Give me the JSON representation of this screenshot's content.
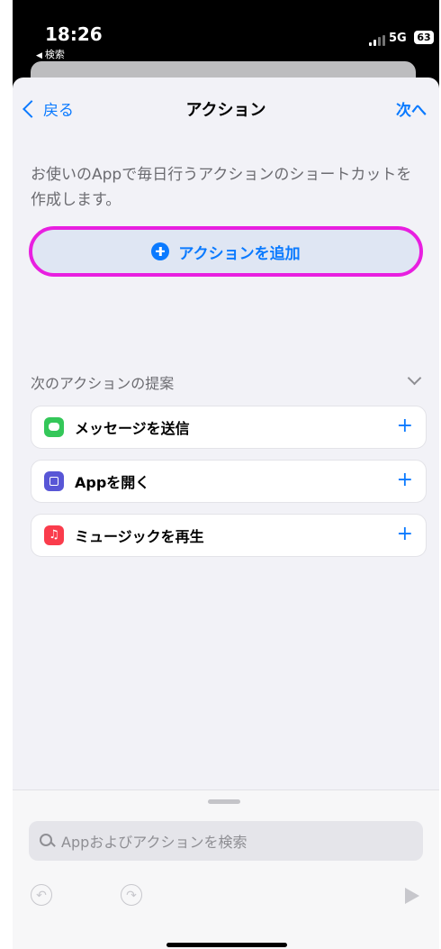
{
  "status": {
    "time": "18:26",
    "back_app": "検索",
    "network": "5G",
    "battery": "63"
  },
  "nav": {
    "back_label": "戻る",
    "title": "アクション",
    "next_label": "次へ"
  },
  "description": "お使いのAppで毎日行うアクションのショートカットを作成します。",
  "add_action": {
    "label": "アクションを追加",
    "highlight_color": "#e81fe0"
  },
  "suggestions": {
    "title": "次のアクションの提案",
    "items": [
      {
        "label": "メッセージを送信",
        "icon": "messages-icon"
      },
      {
        "label": "Appを開く",
        "icon": "open-app-icon"
      },
      {
        "label": "ミュージックを再生",
        "icon": "music-icon"
      }
    ]
  },
  "search": {
    "placeholder": "Appおよびアクションを検索"
  },
  "colors": {
    "accent": "#0a7aff"
  }
}
